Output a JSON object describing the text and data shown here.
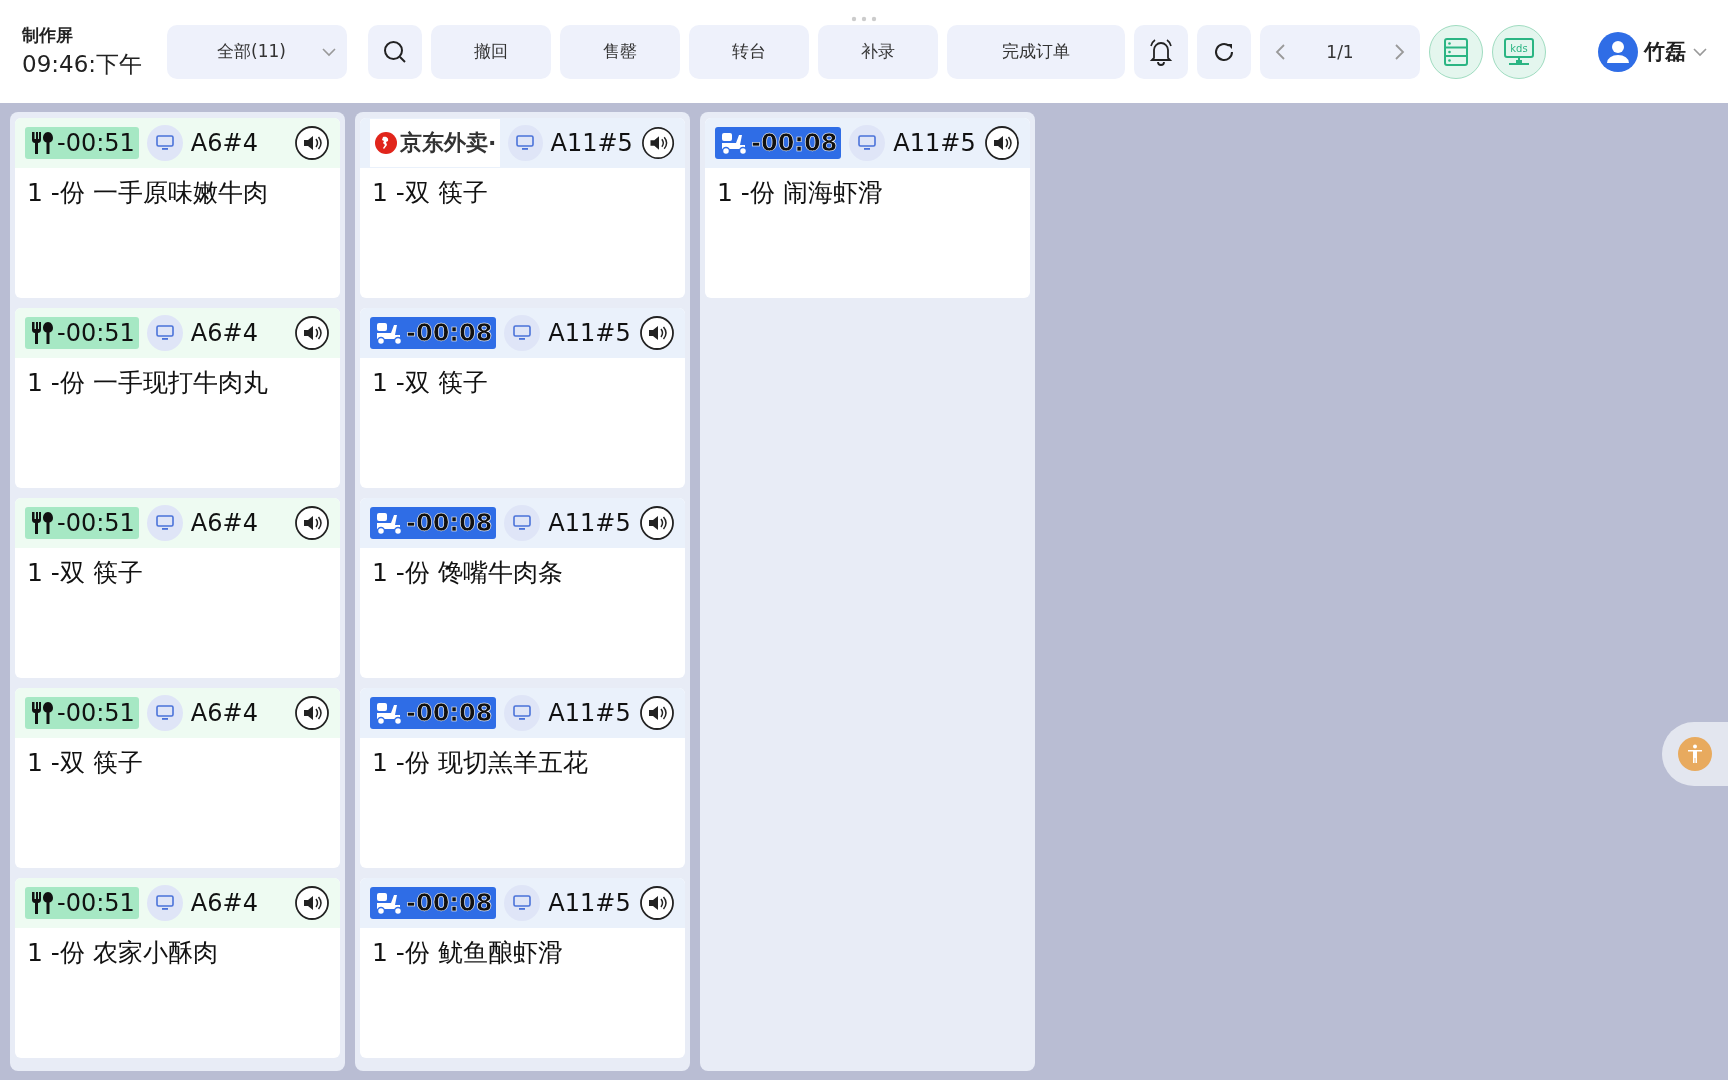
{
  "header": {
    "title": "制作屏",
    "time": "09:46:下午",
    "filter": {
      "value": "全部(11)"
    },
    "actions": [
      "撤回",
      "售罄",
      "转台",
      "补录",
      "完成订单"
    ],
    "pager": "1/1",
    "kds_label": "kds",
    "user": "竹磊"
  },
  "columns": [
    {
      "cards": [
        {
          "kind": "dine_in",
          "timer": "-00:51",
          "table": "A6#4",
          "item": "1 -份 一手原味嫩牛肉"
        },
        {
          "kind": "dine_in",
          "timer": "-00:51",
          "table": "A6#4",
          "item": "1 -份 一手现打牛肉丸"
        },
        {
          "kind": "dine_in",
          "timer": "-00:51",
          "table": "A6#4",
          "item": "1 -双 筷子"
        },
        {
          "kind": "dine_in",
          "timer": "-00:51",
          "table": "A6#4",
          "item": "1 -双 筷子"
        },
        {
          "kind": "dine_in",
          "timer": "-00:51",
          "table": "A6#4",
          "item": "1 -份 农家小酥肉"
        }
      ]
    },
    {
      "cards": [
        {
          "kind": "platform",
          "timer": "京东外卖·",
          "table": "A11#5",
          "item": "1 -双 筷子"
        },
        {
          "kind": "delivery",
          "timer": "-00:08",
          "table": "A11#5",
          "item": "1 -双 筷子"
        },
        {
          "kind": "delivery",
          "timer": "-00:08",
          "table": "A11#5",
          "item": "1 -份 馋嘴牛肉条"
        },
        {
          "kind": "delivery",
          "timer": "-00:08",
          "table": "A11#5",
          "item": "1 -份 现切羔羊五花"
        },
        {
          "kind": "delivery",
          "timer": "-00:08",
          "table": "A11#5",
          "item": "1 -份 鱿鱼酿虾滑"
        }
      ]
    },
    {
      "cards": [
        {
          "kind": "delivery",
          "timer": "-00:08",
          "table": "A11#5",
          "item": "1 -份 闹海虾滑"
        }
      ]
    }
  ]
}
